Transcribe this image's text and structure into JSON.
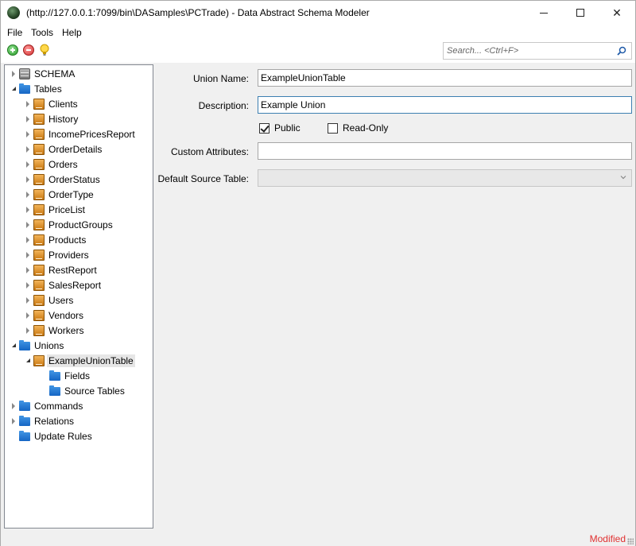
{
  "window": {
    "title": "(http://127.0.0.1:7099/bin\\DASamples\\PCTrade) - Data Abstract Schema Modeler",
    "minimize_label": "",
    "maximize_label": "",
    "close_label": "✕"
  },
  "menu": {
    "items": [
      "File",
      "Tools",
      "Help"
    ]
  },
  "search": {
    "placeholder": "Search... <Ctrl+F>"
  },
  "tree": {
    "schema": "SCHEMA",
    "tables": "Tables",
    "table_items": [
      "Clients",
      "History",
      "IncomePricesReport",
      "OrderDetails",
      "Orders",
      "OrderStatus",
      "OrderType",
      "PriceList",
      "ProductGroups",
      "Products",
      "Providers",
      "RestReport",
      "SalesReport",
      "Users",
      "Vendors",
      "Workers"
    ],
    "unions": "Unions",
    "union_item": "ExampleUnionTable",
    "union_children": [
      "Fields",
      "Source Tables"
    ],
    "commands": "Commands",
    "relations": "Relations",
    "update_rules": "Update Rules"
  },
  "form": {
    "union_name_label": "Union Name:",
    "union_name_value": "ExampleUnionTable",
    "description_label": "Description:",
    "description_value": "Example Union",
    "public_label": "Public",
    "public_checked": true,
    "readonly_label": "Read-Only",
    "readonly_checked": false,
    "custom_attributes_label": "Custom Attributes:",
    "custom_attributes_value": "",
    "default_source_label": "Default Source Table:",
    "default_source_value": ""
  },
  "status": {
    "text": "Modified"
  },
  "colors": {
    "status_modified": "#e03030",
    "folder": "#1f74d4",
    "table": "#e39a33"
  }
}
